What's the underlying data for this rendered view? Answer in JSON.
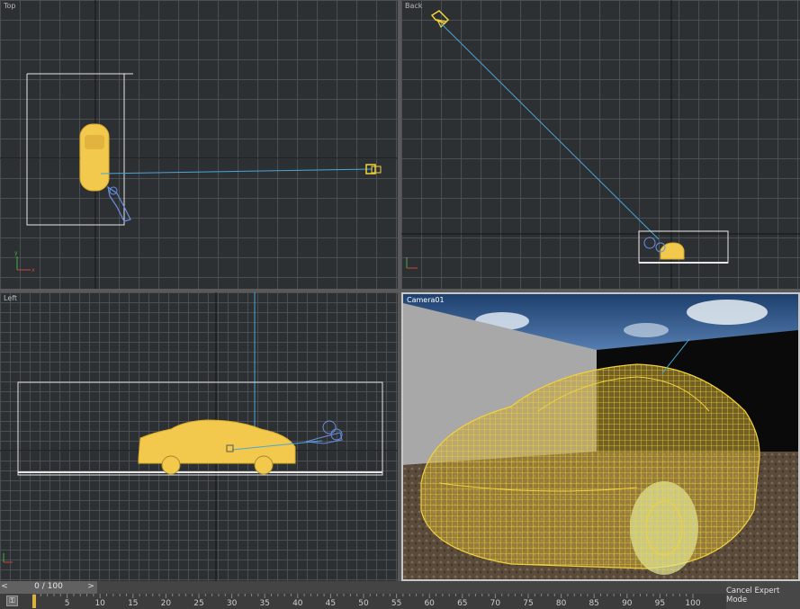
{
  "viewports": {
    "top": {
      "label": "Top"
    },
    "back": {
      "label": "Back"
    },
    "left": {
      "label": "Left"
    },
    "camera": {
      "label": "Camera01"
    }
  },
  "timeline": {
    "frame_display": "0 / 100",
    "prev_arrow": "<",
    "next_arrow": ">",
    "ticks": [
      "5",
      "10",
      "15",
      "20",
      "25",
      "30",
      "35",
      "40",
      "45",
      "50",
      "55",
      "60",
      "65",
      "70",
      "75",
      "80",
      "85",
      "90",
      "95",
      "100"
    ]
  },
  "expert_mode": {
    "label": "Cancel Expert Mode"
  },
  "colors": {
    "viewport_bg": "#2d3033",
    "grid_line": "#4b4f53",
    "selection_wire": "#f2d23c",
    "camera_line": "#4aa6d8"
  },
  "icons": {
    "axis_tripod": "axis-tripod-icon",
    "camera": "camera-icon",
    "light": "direct-light-icon",
    "key": "key-mode-icon"
  }
}
